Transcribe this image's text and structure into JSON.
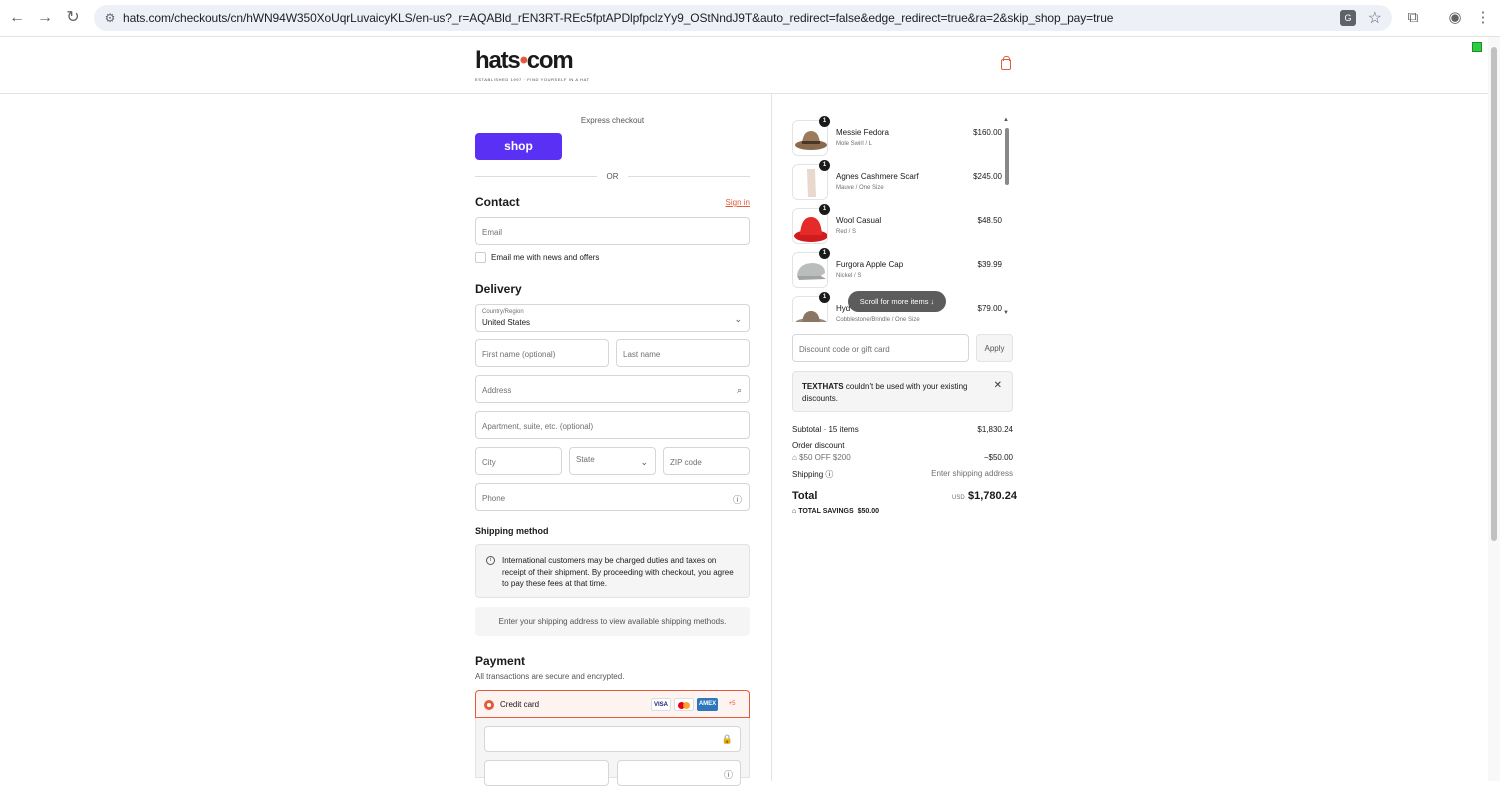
{
  "browser": {
    "url": "hats.com/checkouts/cn/hWN94W350XoUqrLuvaicyKLS/en-us?_r=AQABld_rEN3RT-REc5fptAPDlpfpclzYy9_OStNndJ9T&auto_redirect=false&edge_redirect=true&ra=2&skip_shop_pay=true"
  },
  "header": {
    "logo_text": "hats",
    "logo_dot": "•",
    "logo_suffix": "com",
    "logo_tagline": "ESTABLISHED 1997 · FIND YOURSELF IN A HAT"
  },
  "express": {
    "label": "Express checkout",
    "shop_button": "shop",
    "or_label": "OR"
  },
  "contact": {
    "title": "Contact",
    "sign_in": "Sign in",
    "email_placeholder": "Email",
    "newsletter_label": "Email me with news and offers"
  },
  "delivery": {
    "title": "Delivery",
    "country_label": "Country/Region",
    "country_value": "United States",
    "first_name_placeholder": "First name (optional)",
    "last_name_placeholder": "Last name",
    "address_placeholder": "Address",
    "apartment_placeholder": "Apartment, suite, etc. (optional)",
    "city_placeholder": "City",
    "state_placeholder": "State",
    "zip_placeholder": "ZIP code",
    "phone_placeholder": "Phone"
  },
  "shipping": {
    "title": "Shipping method",
    "notice": "International customers may be charged duties and taxes on receipt of their shipment. By proceeding with checkout, you agree to pay these fees at that time.",
    "empty": "Enter your shipping address to view available shipping methods."
  },
  "payment": {
    "title": "Payment",
    "subtitle": "All transactions are secure and encrypted.",
    "credit_card_label": "Credit card",
    "card_brands": [
      "VISA",
      "",
      "AMEX"
    ],
    "more_cards": "+5"
  },
  "cart": {
    "items": [
      {
        "qty": "1",
        "name": "Messie Fedora",
        "variant": "Mole Swirl / L",
        "price": "$160.00"
      },
      {
        "qty": "1",
        "name": "Agnes Cashmere Scarf",
        "variant": "Mauve / One Size",
        "price": "$245.00"
      },
      {
        "qty": "1",
        "name": "Wool Casual",
        "variant": "Red / S",
        "price": "$48.50"
      },
      {
        "qty": "1",
        "name": "Furgora Apple Cap",
        "variant": "Nickel / S",
        "price": "$39.99"
      },
      {
        "qty": "1",
        "name": "Hyd",
        "variant": "Cobblestone/Brindle / One Size",
        "price": "$79.00"
      }
    ],
    "scroll_hint": "Scroll for more items",
    "scroll_arrow": "↓"
  },
  "discount": {
    "placeholder": "Discount code or gift card",
    "apply": "Apply",
    "error_code": "TEXTHATS",
    "error_text": "couldn't be used with your existing discounts."
  },
  "summary": {
    "subtotal_label": "Subtotal · 15 items",
    "subtotal_value": "$1,830.24",
    "order_discount_label": "Order discount",
    "discount_code": "$50 OFF $200",
    "discount_value": "−$50.00",
    "shipping_label": "Shipping",
    "shipping_value": "Enter shipping address",
    "total_label": "Total",
    "currency": "USD",
    "total_value": "$1,780.24",
    "savings_label": "TOTAL SAVINGS",
    "savings_value": "$50.00"
  },
  "colors": {
    "accent": "#e35b3b",
    "shop_purple": "#5a31f4"
  }
}
